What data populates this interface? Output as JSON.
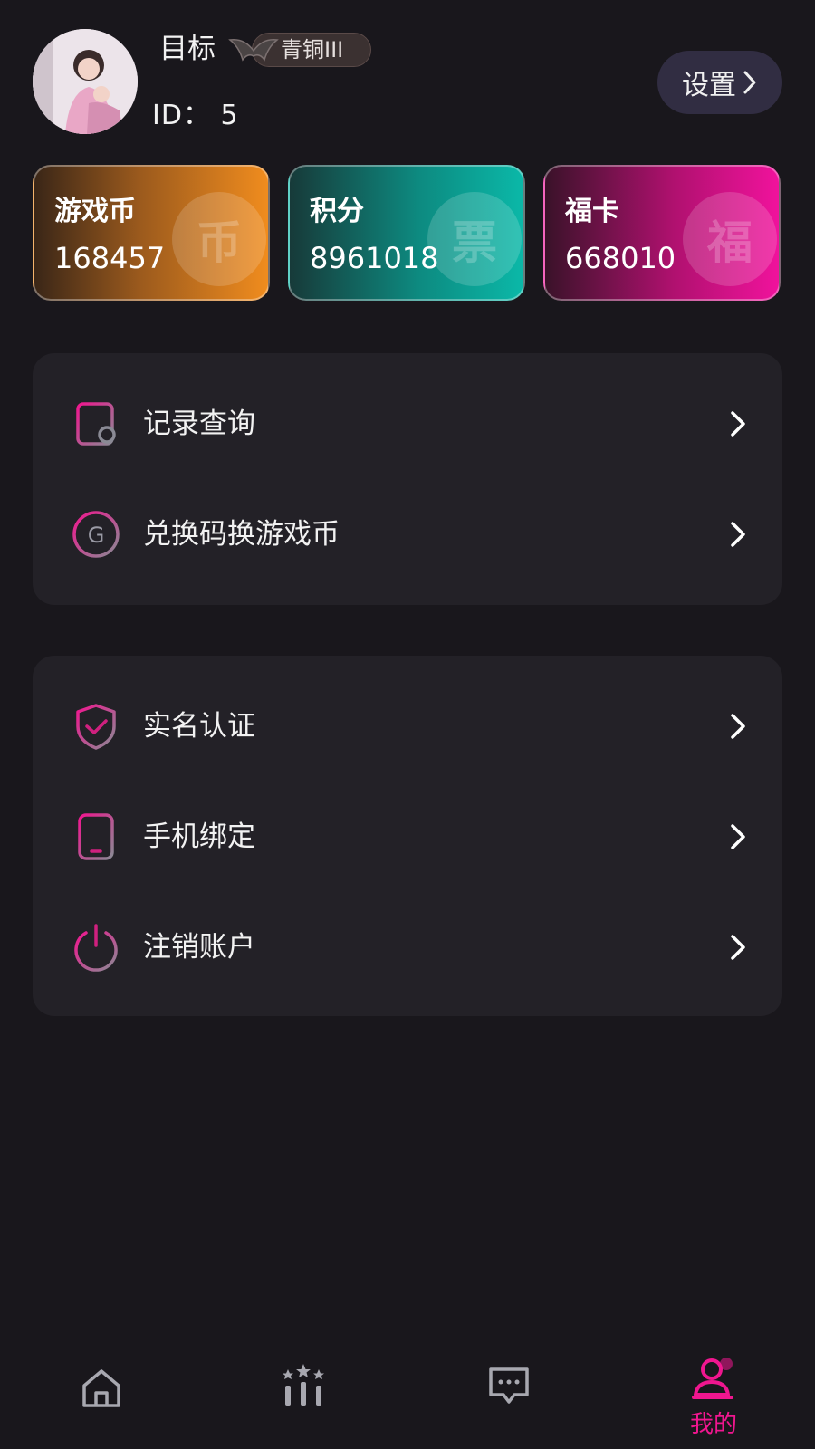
{
  "profile": {
    "name": "目标",
    "rank": "青铜III",
    "id_text": "ID：  5",
    "settings_label": "设置"
  },
  "cards": [
    {
      "title": "游戏币",
      "value": "168457",
      "watermark": "币"
    },
    {
      "title": "积分",
      "value": "8961018",
      "watermark": "票"
    },
    {
      "title": "福卡",
      "value": "668010",
      "watermark": "福"
    }
  ],
  "menu_group_1": [
    {
      "label": "记录查询",
      "icon": "record-icon"
    },
    {
      "label": "兑换码换游戏币",
      "icon": "redeem-code-icon"
    }
  ],
  "menu_group_2": [
    {
      "label": "实名认证",
      "icon": "shield-check-icon"
    },
    {
      "label": "手机绑定",
      "icon": "phone-icon"
    },
    {
      "label": "注销账户",
      "icon": "power-icon"
    }
  ],
  "nav": {
    "items": [
      {
        "icon": "home-icon"
      },
      {
        "icon": "ranking-icon"
      },
      {
        "icon": "message-icon"
      },
      {
        "icon": "profile-icon",
        "label": "我的",
        "active": true
      }
    ]
  },
  "colors": {
    "background": "#19171c",
    "panel": "#232127",
    "accent": "#f0168f",
    "settings_button": "#312d42"
  }
}
